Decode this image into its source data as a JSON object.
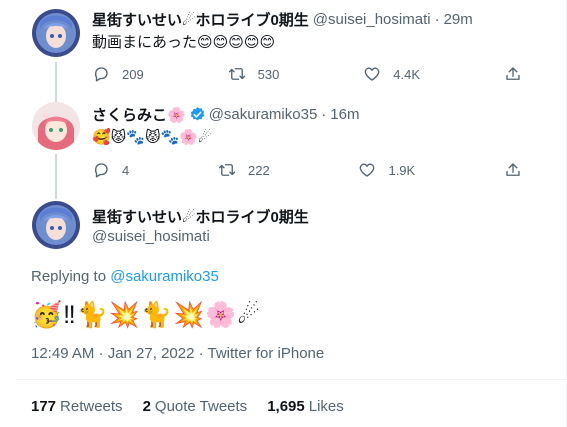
{
  "tweet1": {
    "display_name": "星街すいせい☄ホロライブ0期生",
    "handle": "@suisei_hosimati",
    "separator": "·",
    "time": "29m",
    "text": "動画まにあった😊😊😊😊😊",
    "reply_count": "209",
    "retweet_count": "530",
    "like_count": "4.4K"
  },
  "tweet2": {
    "display_name": "さくらみこ🌸",
    "handle": "@sakuramiko35",
    "separator": "·",
    "time": "16m",
    "text": "🥰😾🐾😾🐾🌸☄",
    "reply_count": "4",
    "retweet_count": "222",
    "like_count": "1.9K"
  },
  "main_tweet": {
    "display_name": "星街すいせい☄ホロライブ0期生",
    "handle": "@suisei_hosimati",
    "replying_prefix": "Replying to",
    "replying_handle": "@sakuramiko35",
    "text": "🥳‼🐈💥🐈💥🌸☄",
    "timestamp": "12:49 AM · Jan 27, 2022 · Twitter for iPhone",
    "retweets_value": "177",
    "retweets_label": "Retweets",
    "quotes_value": "2",
    "quotes_label": "Quote Tweets",
    "likes_value": "1,695",
    "likes_label": "Likes"
  },
  "icons": {
    "reply": "reply-icon",
    "retweet": "retweet-icon",
    "like": "heart-icon",
    "share": "share-icon",
    "verified": "verified-badge-icon"
  },
  "colors": {
    "accent": "#1d9bf0",
    "muted_text": "#536471",
    "thread_line": "#cfd9de"
  }
}
